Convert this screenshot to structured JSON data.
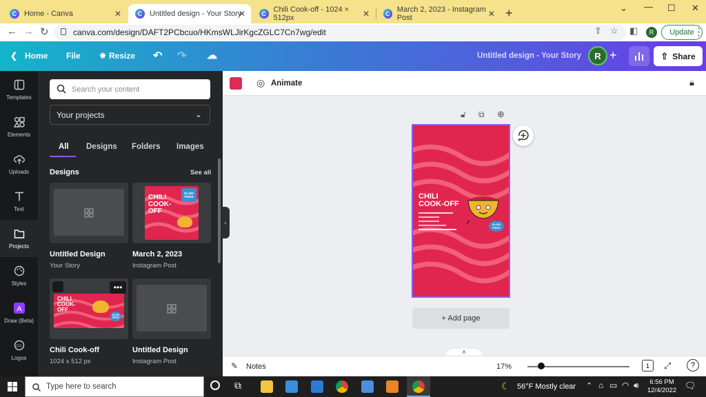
{
  "browser": {
    "tabs": [
      {
        "label": "Home - Canva"
      },
      {
        "label": "Untitled design - Your Story"
      },
      {
        "label": "Chili Cook-off - 1024 × 512px"
      },
      {
        "label": "March 2, 2023 - Instagram Post"
      }
    ],
    "url": "canva.com/design/DAFT2PCbcuo/HKmsWLJirKgcZGLC7Cn7wg/edit",
    "profile_initial": "R",
    "update_label": "Update"
  },
  "canva_bar": {
    "home_label": "Home",
    "file_label": "File",
    "resize_label": "Resize",
    "doc_title": "Untitled design - Your Story",
    "avatar_initial": "R",
    "share_label": "Share"
  },
  "rail": {
    "items": [
      {
        "label": "Templates",
        "icon": "templates-icon"
      },
      {
        "label": "Elements",
        "icon": "elements-icon"
      },
      {
        "label": "Uploads",
        "icon": "uploads-icon"
      },
      {
        "label": "Text",
        "icon": "text-icon"
      },
      {
        "label": "Projects",
        "icon": "projects-icon"
      },
      {
        "label": "Styles",
        "icon": "styles-icon"
      },
      {
        "label": "Draw (Beta)",
        "icon": "draw-icon"
      },
      {
        "label": "Logos",
        "icon": "logos-icon"
      }
    ]
  },
  "panel": {
    "search_placeholder": "Search your content",
    "project_select": "Your projects",
    "tabs": [
      {
        "label": "All"
      },
      {
        "label": "Designs"
      },
      {
        "label": "Folders"
      },
      {
        "label": "Images"
      }
    ],
    "section_title": "Designs",
    "see_all": "See all",
    "designs": [
      {
        "title": "Untitled Design",
        "subtitle": "Your Story"
      },
      {
        "title": "March 2, 2023",
        "subtitle": "Instagram Post"
      },
      {
        "title": "Chili Cook-off",
        "subtitle": "1024 x 512 px"
      },
      {
        "title": "Untitled Design",
        "subtitle": "Instagram Post"
      }
    ],
    "thumb_chili_title": "CHILI COOK-OFF",
    "thumb_prize": "$1,000 PRIZE"
  },
  "editor": {
    "animate_label": "Animate",
    "accent_color": "#e02a52",
    "selection_color": "#8b5cf6",
    "page_title": "CHILI COOK-OFF",
    "page_prize": "$1,000 PRIZE",
    "add_page_label": "+ Add page",
    "notes_label": "Notes",
    "zoom_label": "17%",
    "zoom_level": 0.17
  },
  "taskbar": {
    "search_placeholder": "Type here to search",
    "weather": "56°F  Mostly clear",
    "time": "6:56 PM",
    "date": "12/4/2022"
  }
}
